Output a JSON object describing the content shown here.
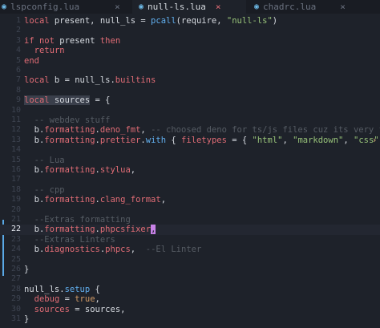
{
  "tabs": [
    {
      "icon": "lua-file-icon",
      "glyph": "◉",
      "name": "lspconfig.lua",
      "close": "×",
      "active": false
    },
    {
      "icon": "lua-file-icon",
      "glyph": "◉",
      "name": "null-ls.lua",
      "close": "×",
      "active": true
    },
    {
      "icon": "lua-file-icon",
      "glyph": "◉",
      "name": "chadrc.lua",
      "close": "×",
      "active": false
    }
  ],
  "editor": {
    "current_line": 22,
    "overflow_marker": "›",
    "lines": [
      {
        "n": "1",
        "tokens": [
          [
            "kw",
            "local"
          ],
          [
            "pl",
            " present, null_ls = "
          ],
          [
            "fn",
            "pcall"
          ],
          [
            "pl",
            "(require, "
          ],
          [
            "str",
            "\"null-ls\""
          ],
          [
            "pl",
            ")"
          ]
        ]
      },
      {
        "n": "2",
        "tokens": []
      },
      {
        "n": "3",
        "tokens": [
          [
            "kw",
            "if"
          ],
          [
            "pl",
            " "
          ],
          [
            "kw",
            "not"
          ],
          [
            "pl",
            " present "
          ],
          [
            "kw",
            "then"
          ]
        ]
      },
      {
        "n": "4",
        "tokens": [
          [
            "pl",
            "  "
          ],
          [
            "kw",
            "return"
          ]
        ]
      },
      {
        "n": "5",
        "tokens": [
          [
            "kw",
            "end"
          ]
        ]
      },
      {
        "n": "6",
        "tokens": []
      },
      {
        "n": "7",
        "tokens": [
          [
            "kw",
            "local"
          ],
          [
            "pl",
            " b = null_ls."
          ],
          [
            "fld",
            "builtins"
          ]
        ]
      },
      {
        "n": "8",
        "tokens": []
      },
      {
        "n": "9",
        "tokens": [
          [
            "hlkw",
            "local"
          ],
          [
            "hlpl",
            " sources"
          ],
          [
            "pl",
            " = {"
          ]
        ]
      },
      {
        "n": "10",
        "tokens": []
      },
      {
        "n": "11",
        "tokens": [
          [
            "pl",
            "  "
          ],
          [
            "cmt",
            "-- webdev stuff"
          ]
        ]
      },
      {
        "n": "12",
        "tokens": [
          [
            "pl",
            "  b."
          ],
          [
            "fld",
            "formatting"
          ],
          [
            "pl",
            "."
          ],
          [
            "fld",
            "deno_fmt"
          ],
          [
            "pl",
            ", "
          ],
          [
            "cmt",
            "-- choosed deno for ts/js files cuz its very fast!"
          ]
        ]
      },
      {
        "n": "13",
        "tokens": [
          [
            "pl",
            "  b."
          ],
          [
            "fld",
            "formatting"
          ],
          [
            "pl",
            "."
          ],
          [
            "fld",
            "prettier"
          ],
          [
            "pl",
            "."
          ],
          [
            "fn",
            "with"
          ],
          [
            "pl",
            " { "
          ],
          [
            "fld",
            "filetypes"
          ],
          [
            "pl",
            " = { "
          ],
          [
            "str",
            "\"html\""
          ],
          [
            "pl",
            ", "
          ],
          [
            "str",
            "\"markdown\""
          ],
          [
            "pl",
            ", "
          ],
          [
            "str",
            "\"css\""
          ],
          [
            "pl",
            " } },"
          ]
        ]
      },
      {
        "n": "14",
        "tokens": []
      },
      {
        "n": "15",
        "tokens": [
          [
            "pl",
            "  "
          ],
          [
            "cmt",
            "-- Lua"
          ]
        ]
      },
      {
        "n": "16",
        "tokens": [
          [
            "pl",
            "  b."
          ],
          [
            "fld",
            "formatting"
          ],
          [
            "pl",
            "."
          ],
          [
            "fld",
            "stylua"
          ],
          [
            "pl",
            ","
          ]
        ]
      },
      {
        "n": "17",
        "tokens": []
      },
      {
        "n": "18",
        "tokens": [
          [
            "pl",
            "  "
          ],
          [
            "cmt",
            "-- cpp"
          ]
        ]
      },
      {
        "n": "19",
        "tokens": [
          [
            "pl",
            "  b."
          ],
          [
            "fld",
            "formatting"
          ],
          [
            "pl",
            "."
          ],
          [
            "fld",
            "clang_format"
          ],
          [
            "pl",
            ","
          ]
        ]
      },
      {
        "n": "20",
        "tokens": []
      },
      {
        "n": "21",
        "tokens": [
          [
            "pl",
            "  "
          ],
          [
            "cmt",
            "--Extras formatting"
          ]
        ]
      },
      {
        "n": "22",
        "tokens": [
          [
            "pl",
            "  b."
          ],
          [
            "fld",
            "formatting"
          ],
          [
            "pl",
            "."
          ],
          [
            "fld",
            "phpcsfixer"
          ],
          [
            "cursor",
            ","
          ]
        ]
      },
      {
        "n": "23",
        "tokens": [
          [
            "pl",
            "  "
          ],
          [
            "cmt",
            "--Extras Linters"
          ]
        ]
      },
      {
        "n": "24",
        "tokens": [
          [
            "pl",
            "  b."
          ],
          [
            "fld",
            "diagnostics"
          ],
          [
            "pl",
            "."
          ],
          [
            "fld",
            "phpcs"
          ],
          [
            "pl",
            ",  "
          ],
          [
            "cmt",
            "--El Linter"
          ]
        ]
      },
      {
        "n": "25",
        "tokens": []
      },
      {
        "n": "26",
        "tokens": [
          [
            "pl",
            "}"
          ]
        ]
      },
      {
        "n": "27",
        "tokens": []
      },
      {
        "n": "28",
        "tokens": [
          [
            "pl",
            "null_ls."
          ],
          [
            "fn",
            "setup"
          ],
          [
            "pl",
            " {"
          ]
        ]
      },
      {
        "n": "29",
        "tokens": [
          [
            "pl",
            "  "
          ],
          [
            "fld",
            "debug"
          ],
          [
            "pl",
            " = "
          ],
          [
            "bool",
            "true"
          ],
          [
            "pl",
            ","
          ]
        ]
      },
      {
        "n": "30",
        "tokens": [
          [
            "pl",
            "  "
          ],
          [
            "fld",
            "sources"
          ],
          [
            "pl",
            " = sources,"
          ]
        ]
      },
      {
        "n": "31",
        "tokens": [
          [
            "pl",
            "}"
          ]
        ]
      }
    ]
  }
}
